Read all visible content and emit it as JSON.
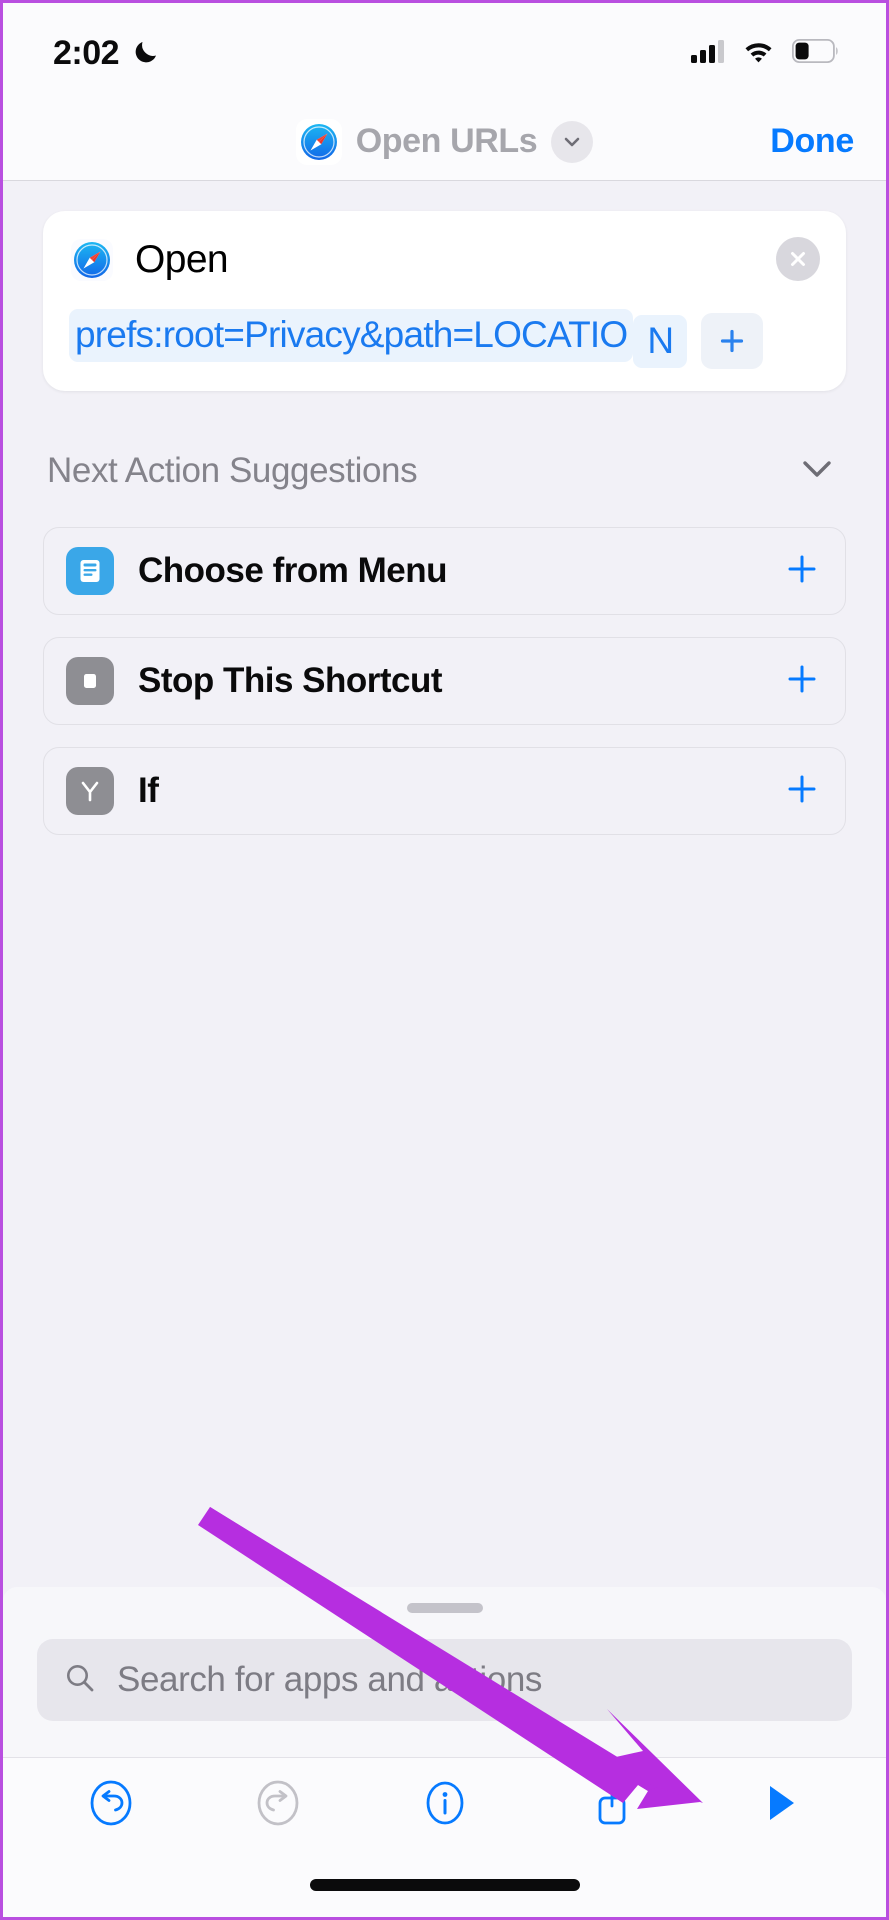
{
  "status_bar": {
    "time": "2:02",
    "moon_icon": "crescent-moon-icon",
    "cellular_icon": "cellular-signal-icon",
    "wifi_icon": "wifi-icon",
    "battery_icon": "battery-icon",
    "signal_bars_filled": 3,
    "signal_bars_total": 4,
    "battery_percent": 35
  },
  "nav_bar": {
    "app_icon": "safari-icon",
    "title": "Open URLs",
    "chevron_icon": "chevron-down-icon",
    "done_label": "Done"
  },
  "action_card": {
    "app_icon": "safari-icon",
    "verb": "Open",
    "close_icon": "close-circle-icon",
    "url_line1": "prefs:root=Privacy&path=LOCATIO",
    "url_line2": "N",
    "add_variable_icon": "plus-icon"
  },
  "suggestions": {
    "header": "Next Action Suggestions",
    "collapse_icon": "chevron-down-icon",
    "items": [
      {
        "label": "Choose from Menu",
        "icon": "menu-list-icon",
        "icon_color": "#3aa7e8",
        "add_icon": "plus-icon"
      },
      {
        "label": "Stop This Shortcut",
        "icon": "stop-square-icon",
        "icon_color": "#8e8e93",
        "add_icon": "plus-icon"
      },
      {
        "label": "If",
        "icon": "branch-icon",
        "icon_color": "#8e8e93",
        "add_icon": "plus-icon"
      }
    ]
  },
  "sheet": {
    "grabber": "drag-handle",
    "search_icon": "search-icon",
    "search_value": "",
    "search_placeholder": "Search for apps and actions"
  },
  "toolbar": {
    "buttons": [
      {
        "name": "undo-button",
        "icon": "undo-icon",
        "enabled": true
      },
      {
        "name": "redo-button",
        "icon": "redo-icon",
        "enabled": false
      },
      {
        "name": "info-button",
        "icon": "info-icon",
        "enabled": true
      },
      {
        "name": "share-button",
        "icon": "share-icon",
        "enabled": true
      },
      {
        "name": "run-button",
        "icon": "play-icon",
        "enabled": true
      }
    ]
  },
  "annotation": {
    "arrow_color": "#b62ee0",
    "points_to": "share-button"
  },
  "colors": {
    "accent_blue": "#067aff",
    "link_blue": "#1a7af0",
    "background": "#f2f1f7",
    "card_white": "#ffffff",
    "muted_text": "#84838b",
    "border_purple": "#b94fe0"
  }
}
